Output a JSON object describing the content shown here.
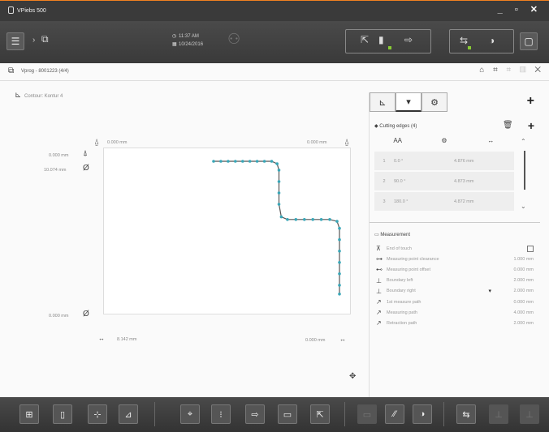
{
  "window": {
    "app_title": "VPiebs 500",
    "controls": "_ ▫ ✕"
  },
  "toolbar": {
    "menu_icon": "☰",
    "crumb_arrow": "›",
    "crumb_icon": "⧉",
    "time": "11:37 AM",
    "date": "10/24/2016",
    "user_icon": "⚇",
    "status_icons": [
      "⇱",
      "▮",
      "⇨"
    ],
    "right_icons": [
      "⇆",
      "◑"
    ],
    "chat_icon": "▢"
  },
  "tab": {
    "icon": "⧉",
    "title": "Vprog - 8001223 (4/4)",
    "actions": [
      "⌂",
      "⌗",
      "⌗",
      "▥",
      "✕"
    ]
  },
  "contour": {
    "icon": "⊾",
    "label": "Contour: Kontur 4"
  },
  "plot": {
    "top_left_value": "0.000 mm",
    "top_right_value": "0.000 mm",
    "left_top_value": "0.000 mm",
    "left_mid_value": "10.074 mm",
    "left_bottom_value": "0.000 mm",
    "bottom_left_value": "8.142 mm",
    "bottom_right_value": "0.000 mm",
    "contour_points": [
      [
        0,
        0
      ],
      [
        0.6,
        0
      ],
      [
        1.2,
        0
      ],
      [
        1.8,
        0
      ],
      [
        2.4,
        0
      ],
      [
        3.0,
        0
      ],
      [
        3.6,
        0
      ],
      [
        4.2,
        0
      ],
      [
        4.8,
        0
      ],
      [
        5.25,
        -0.2
      ],
      [
        5.4,
        -0.7
      ],
      [
        5.4,
        -1.6
      ],
      [
        5.4,
        -2.5
      ],
      [
        5.4,
        -3.4
      ],
      [
        5.6,
        -4.4
      ],
      [
        6.1,
        -4.6
      ],
      [
        6.8,
        -4.6
      ],
      [
        7.5,
        -4.6
      ],
      [
        8.2,
        -4.6
      ],
      [
        8.9,
        -4.6
      ],
      [
        9.6,
        -4.6
      ],
      [
        10.2,
        -4.75
      ],
      [
        10.4,
        -5.3
      ],
      [
        10.4,
        -6.2
      ],
      [
        10.4,
        -7.1
      ],
      [
        10.4,
        -8.0
      ],
      [
        10.4,
        -8.9
      ],
      [
        10.4,
        -9.8
      ],
      [
        10.4,
        -10.5
      ]
    ]
  },
  "panel": {
    "tabs": [
      "⊾",
      "▾",
      "⚙"
    ],
    "plus": "+",
    "cutting_edges": {
      "title": "Cutting edges (4)",
      "headers": [
        "AA",
        "⚙",
        "↔"
      ],
      "rows": [
        {
          "n": "1",
          "angle": "0.0 °",
          "len": "4.876 mm"
        },
        {
          "n": "2",
          "angle": "90.0 °",
          "len": "4.873 mm"
        },
        {
          "n": "3",
          "angle": "180.0 °",
          "len": "4.872 mm"
        }
      ]
    },
    "measurement": {
      "title": "Measurement",
      "items": [
        {
          "icon": "⊼",
          "label": "End of touch",
          "value": ""
        },
        {
          "icon": "⊶",
          "label": "Measuring point clearance",
          "value": "1.000 mm"
        },
        {
          "icon": "⊷",
          "label": "Measuring point offset",
          "value": "0.000 mm"
        },
        {
          "icon": "⊥",
          "label": "Boundary left",
          "value": "2.000 mm"
        },
        {
          "icon": "⊥",
          "label": "Boundary right",
          "value": "2.000 mm"
        },
        {
          "icon": "↗",
          "label": "1st measure path",
          "value": "0.000 mm"
        },
        {
          "icon": "↗",
          "label": "Measuring path",
          "value": "4.000 mm"
        },
        {
          "icon": "↗",
          "label": "Retraction path",
          "value": "2.000 mm"
        }
      ]
    }
  },
  "bottombar": {
    "left_icons": [
      "⊞",
      "▯",
      "⊹",
      "⊿"
    ],
    "mid_icons": [
      "⌖",
      "⁝",
      "⇨",
      "▭",
      "⇱"
    ],
    "right_icons": [
      "▭",
      "⁄⁄",
      "◑"
    ],
    "far_icons": [
      "⇆",
      "⊥",
      "⊥"
    ]
  }
}
